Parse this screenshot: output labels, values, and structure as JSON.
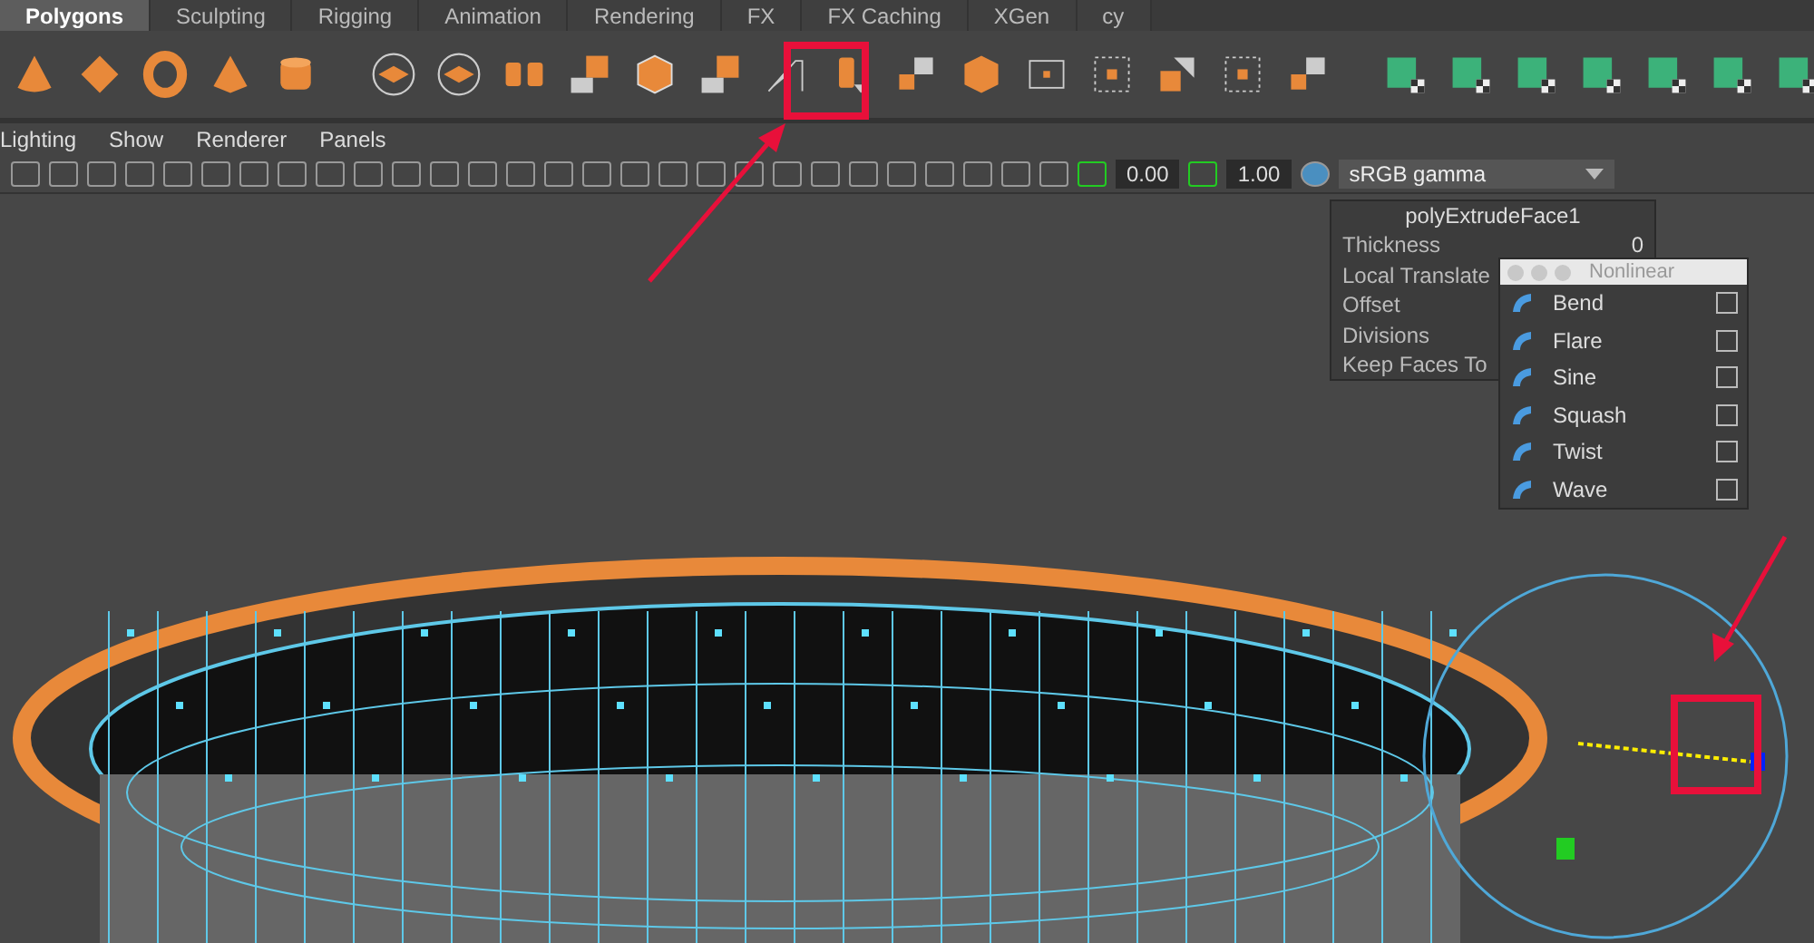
{
  "shelf_tabs": [
    {
      "label": "Polygons",
      "selected": true
    },
    {
      "label": "Sculpting",
      "selected": false
    },
    {
      "label": "Rigging",
      "selected": false
    },
    {
      "label": "Animation",
      "selected": false
    },
    {
      "label": "Rendering",
      "selected": false
    },
    {
      "label": "FX",
      "selected": false
    },
    {
      "label": "FX Caching",
      "selected": false
    },
    {
      "label": "XGen",
      "selected": false
    },
    {
      "label": "cy",
      "selected": false
    }
  ],
  "panel_menu": [
    "Lighting",
    "Show",
    "Renderer",
    "Panels"
  ],
  "panel_toolbar": {
    "exposure": "0.00",
    "gamma": "1.00",
    "color_space": "sRGB gamma"
  },
  "channel_box": {
    "title": "polyExtrudeFace1",
    "attributes": [
      {
        "label": "Thickness",
        "value": "0"
      },
      {
        "label": "Local Translate"
      },
      {
        "label": "Offset"
      },
      {
        "label": "Divisions"
      },
      {
        "label": "Keep Faces To"
      }
    ]
  },
  "nonlinear_menu": {
    "title": "Nonlinear",
    "items": [
      {
        "label": "Bend",
        "checked": false
      },
      {
        "label": "Flare",
        "checked": false
      },
      {
        "label": "Sine",
        "checked": false
      },
      {
        "label": "Squash",
        "checked": false
      },
      {
        "label": "Twist",
        "checked": false
      },
      {
        "label": "Wave",
        "checked": false
      }
    ]
  }
}
